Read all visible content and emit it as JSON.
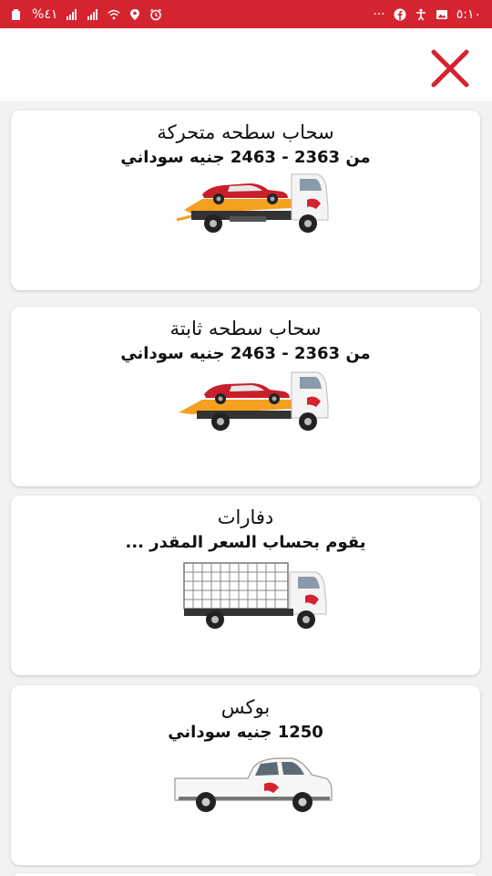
{
  "status_bar": {
    "time": "٥:١٠",
    "battery": "%٤١",
    "more": "···",
    "colors": {
      "bar": "#d5232f"
    }
  },
  "header": {
    "close_icon": "close-x-icon",
    "close_color": "#d5232f"
  },
  "services": [
    {
      "title": "سحاب سطحه متحركة",
      "price": "من 2363 - 2463 جنيه سوداني",
      "vehicle": "tow-truck-movable-flatbed-icon"
    },
    {
      "title": "سحاب سطحه ثابتة",
      "price": "من 2363 - 2463 جنيه سوداني",
      "vehicle": "tow-truck-fixed-flatbed-icon"
    },
    {
      "title": "دفارات",
      "price": "يقوم بحساب السعر المقدر ...",
      "vehicle": "cargo-truck-icon"
    },
    {
      "title": "بوكس",
      "price": "1250 جنيه سوداني",
      "vehicle": "pickup-truck-icon"
    }
  ]
}
